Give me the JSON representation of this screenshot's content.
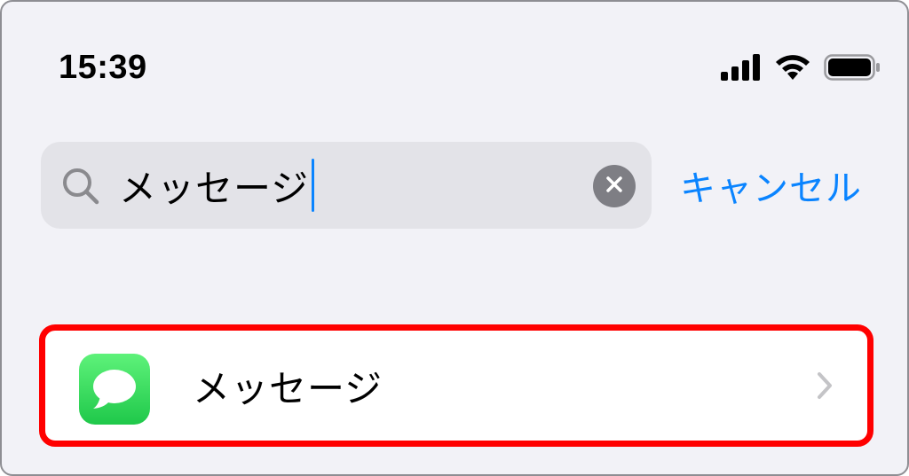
{
  "status_bar": {
    "time": "15:39",
    "icons": [
      "cellular-signal-icon",
      "wifi-icon",
      "battery-icon"
    ]
  },
  "search": {
    "value": "メッセージ",
    "icon": "search-icon",
    "clear_icon": "clear-icon",
    "cancel_label": "キャンセル"
  },
  "results": [
    {
      "label": "メッセージ",
      "icon": "messages-app-icon",
      "highlighted": true
    }
  ],
  "colors": {
    "background": "#f2f2f7",
    "accent": "#0a84ff",
    "highlight_border": "#ff0000",
    "app_icon_green": "#2ad352"
  }
}
